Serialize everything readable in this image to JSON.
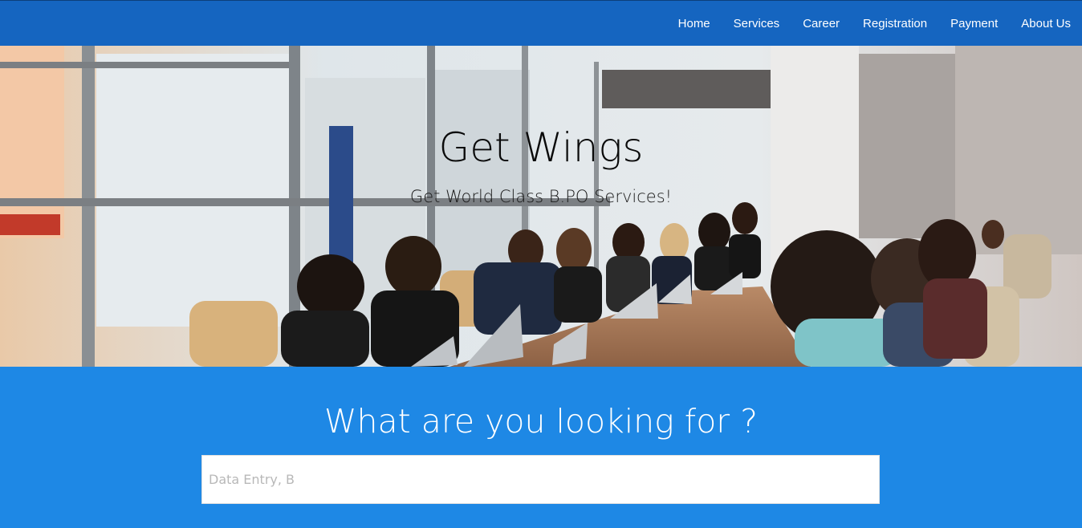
{
  "nav": {
    "items": [
      {
        "label": "Home"
      },
      {
        "label": "Services"
      },
      {
        "label": "Career"
      },
      {
        "label": "Registration"
      },
      {
        "label": "Payment"
      },
      {
        "label": "About Us"
      }
    ]
  },
  "hero": {
    "title": "Get Wings",
    "subtitle": "Get World Class B.PO Services!",
    "image_semantic": "office-meeting-photo"
  },
  "search": {
    "heading": "What are you looking for ?",
    "placeholder": "Data Entry, B"
  },
  "colors": {
    "navbar": "#1565c0",
    "section_bg": "#1e88e5",
    "text_light": "#ffffff"
  }
}
